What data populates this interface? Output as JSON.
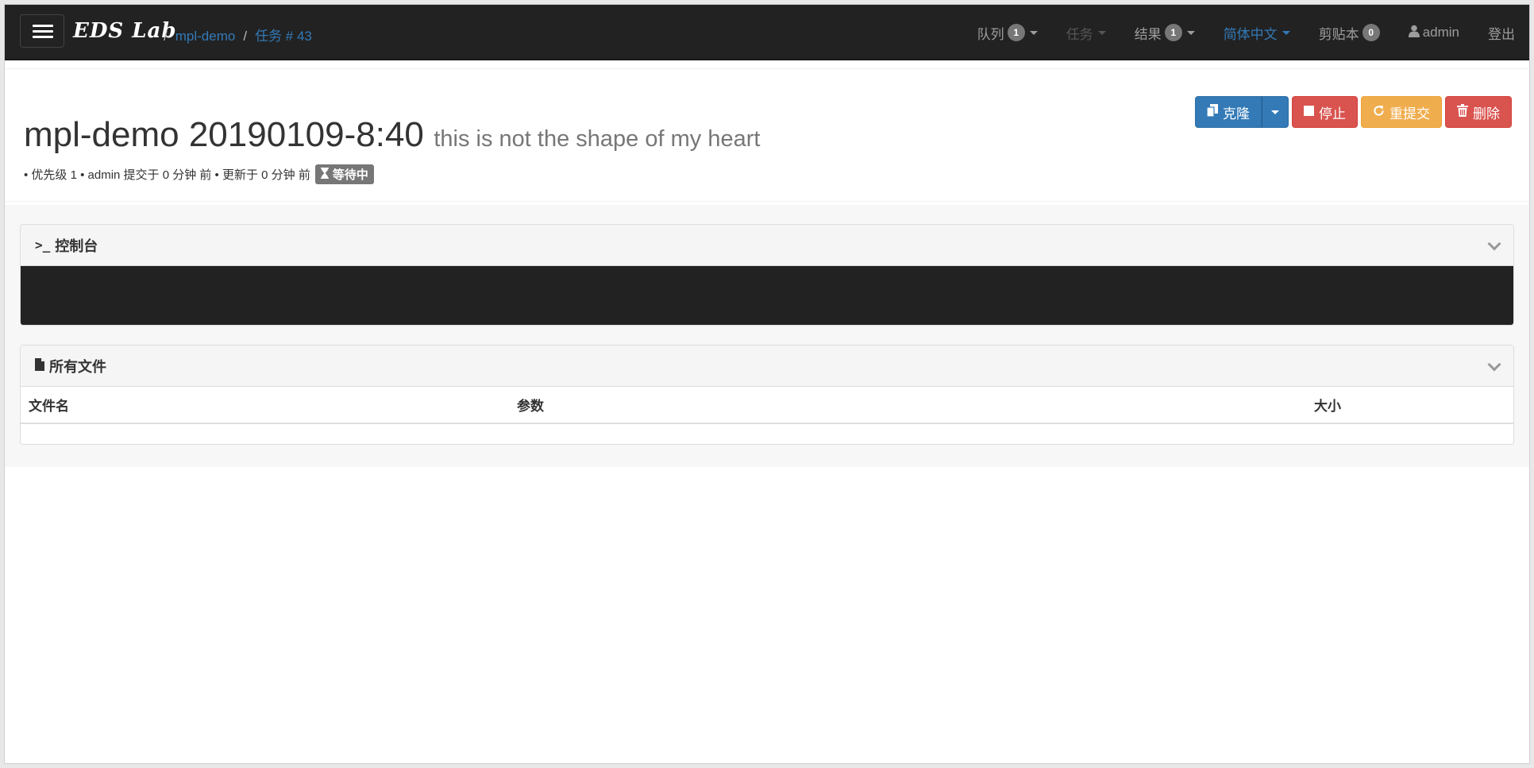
{
  "navbar": {
    "brand": "EDS Lab",
    "breadcrumb": [
      {
        "label": "mpl-demo"
      },
      {
        "label": "任务 # 43"
      }
    ],
    "separator": "/",
    "queue": {
      "label": "队列",
      "badge": "1"
    },
    "tasks": {
      "label": "任务"
    },
    "results": {
      "label": "结果",
      "badge": "1"
    },
    "language": {
      "label": "简体中文"
    },
    "clipboard": {
      "label": "剪贴本",
      "badge": "0"
    },
    "user": {
      "label": "admin"
    },
    "logout": {
      "label": "登出"
    }
  },
  "task": {
    "title": "mpl-demo 20190109-8:40",
    "subtitle": "this is not the shape of my heart",
    "meta": "• 优先级 1 • admin 提交于 0 分钟 前 • 更新于 0 分钟 前",
    "status": "等待中"
  },
  "actions": {
    "clone": "克隆",
    "stop": "停止",
    "resubmit": "重提交",
    "delete": "删除"
  },
  "console_panel": {
    "title": "控制台"
  },
  "files_panel": {
    "title": "所有文件",
    "columns": [
      "文件名",
      "参数",
      "大小"
    ]
  },
  "colors": {
    "navbar_bg": "#222222",
    "link": "#337ab7",
    "primary": "#337ab7",
    "danger": "#d9534f",
    "warning": "#f0ad4e",
    "badge": "#777777"
  },
  "icons": [
    "hamburger-icon",
    "user-icon",
    "clone-icon",
    "stop-icon",
    "refresh-icon",
    "trash-icon",
    "hourglass-icon",
    "terminal-icon",
    "file-icon",
    "chevron-down-icon"
  ]
}
